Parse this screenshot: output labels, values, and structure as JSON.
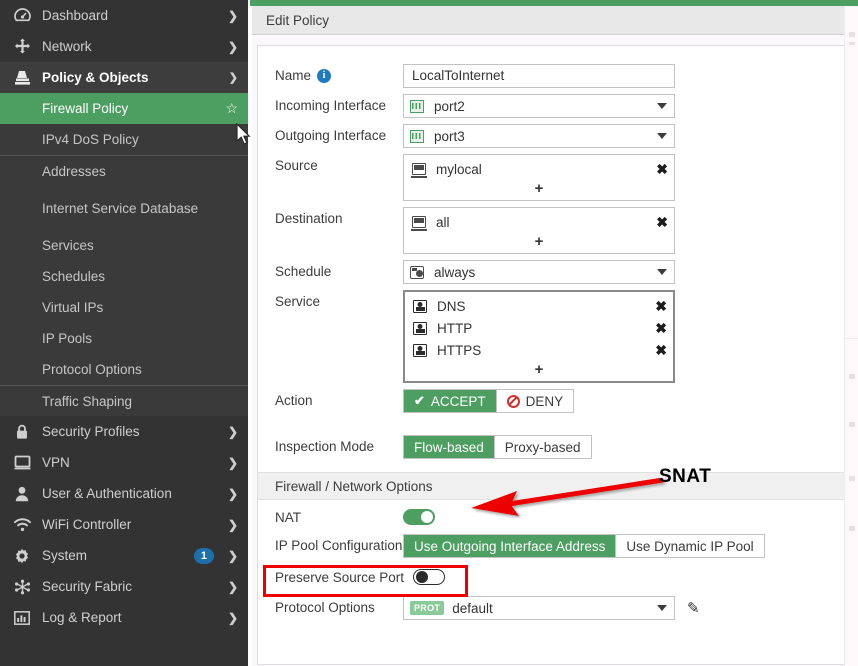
{
  "theme": {
    "accent_green": "#4d9e61",
    "sidebar_bg": "#333333",
    "badge_blue": "#1e6fa8",
    "annotation_red": "#ee0000",
    "deny_red": "#d0342c"
  },
  "sidebar": {
    "items": [
      {
        "label": "Dashboard",
        "icon": "dashboard-gauge-icon",
        "chevron": "right",
        "type": "top"
      },
      {
        "label": "Network",
        "icon": "network-arrows-icon",
        "chevron": "right",
        "type": "top"
      },
      {
        "label": "Policy & Objects",
        "icon": "policy-stamp-icon",
        "chevron": "down",
        "type": "expanded"
      },
      {
        "label": "Firewall Policy",
        "type": "sub-active",
        "star": "☆"
      },
      {
        "label": "IPv4 DoS Policy",
        "type": "sub"
      },
      {
        "label": "Addresses",
        "type": "sub",
        "divider_above": true
      },
      {
        "label": "Internet Service Database",
        "type": "sub-two-line"
      },
      {
        "label": "Services",
        "type": "sub"
      },
      {
        "label": "Schedules",
        "type": "sub"
      },
      {
        "label": "Virtual IPs",
        "type": "sub"
      },
      {
        "label": "IP Pools",
        "type": "sub"
      },
      {
        "label": "Protocol Options",
        "type": "sub"
      },
      {
        "label": "Traffic Shaping",
        "type": "sub",
        "divider_above": true
      },
      {
        "label": "Security Profiles",
        "icon": "lock-icon",
        "chevron": "right",
        "type": "top"
      },
      {
        "label": "VPN",
        "icon": "monitor-icon",
        "chevron": "right",
        "type": "top"
      },
      {
        "label": "User & Authentication",
        "icon": "user-icon",
        "chevron": "right",
        "type": "top"
      },
      {
        "label": "WiFi Controller",
        "icon": "wifi-icon",
        "chevron": "right",
        "type": "top"
      },
      {
        "label": "System",
        "icon": "gear-icon",
        "chevron": "right",
        "type": "top",
        "badge": "1"
      },
      {
        "label": "Security Fabric",
        "icon": "fabric-nodes-icon",
        "chevron": "right",
        "type": "top"
      },
      {
        "label": "Log & Report",
        "icon": "chart-bars-icon",
        "chevron": "right",
        "type": "top"
      }
    ]
  },
  "header": {
    "title": "Edit Policy"
  },
  "form": {
    "name": {
      "label": "Name",
      "value": "LocalToInternet",
      "info_icon": "info-icon"
    },
    "incoming_interface": {
      "label": "Incoming Interface",
      "value": "port2",
      "icon": "port-icon"
    },
    "outgoing_interface": {
      "label": "Outgoing Interface",
      "value": "port3",
      "icon": "port-icon"
    },
    "source": {
      "label": "Source",
      "entries": [
        {
          "value": "mylocal",
          "icon": "host-address-icon",
          "remove": "✖"
        }
      ],
      "add": "+"
    },
    "destination": {
      "label": "Destination",
      "entries": [
        {
          "value": "all",
          "icon": "host-address-icon",
          "remove": "✖"
        }
      ],
      "add": "+"
    },
    "schedule": {
      "label": "Schedule",
      "value": "always",
      "icon": "schedule-clock-icon"
    },
    "service": {
      "label": "Service",
      "entries": [
        {
          "value": "DNS",
          "icon": "service-icon",
          "remove": "✖"
        },
        {
          "value": "HTTP",
          "icon": "service-icon",
          "remove": "✖"
        },
        {
          "value": "HTTPS",
          "icon": "service-icon",
          "remove": "✖"
        }
      ],
      "add": "+"
    },
    "action": {
      "label": "Action",
      "options": [
        {
          "label": "ACCEPT",
          "selected": true,
          "icon": "check-icon"
        },
        {
          "label": "DENY",
          "selected": false,
          "icon": "deny-icon"
        }
      ]
    },
    "inspection_mode": {
      "label": "Inspection Mode",
      "options": [
        {
          "label": "Flow-based",
          "selected": true
        },
        {
          "label": "Proxy-based",
          "selected": false
        }
      ]
    }
  },
  "network_options": {
    "section_title": "Firewall / Network Options",
    "nat": {
      "label": "NAT",
      "state": "on"
    },
    "ip_pool_configuration": {
      "label": "IP Pool Configuration",
      "options": [
        {
          "label": "Use Outgoing Interface Address",
          "selected": true
        },
        {
          "label": "Use Dynamic IP Pool",
          "selected": false
        }
      ]
    },
    "preserve_source_port": {
      "label": "Preserve Source Port",
      "state": "off"
    },
    "protocol_options": {
      "label": "Protocol Options",
      "badge": "PROT",
      "value": "default",
      "edit_icon": "pencil-icon"
    }
  },
  "annotation": {
    "label": "SNAT",
    "arrow": "arrow-pointing-to-nat-row"
  }
}
